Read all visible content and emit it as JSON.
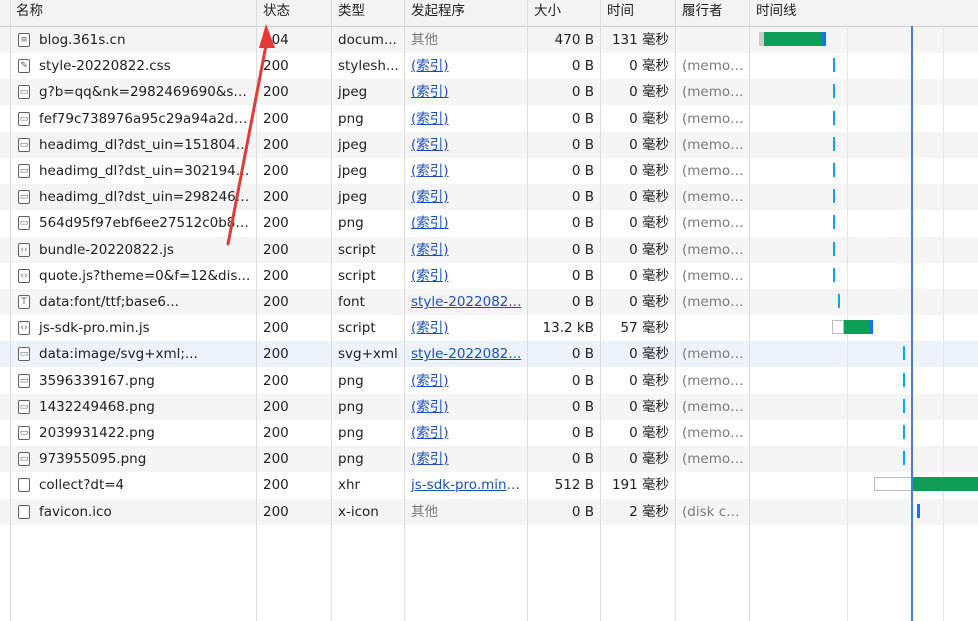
{
  "columns": {
    "name": "名称",
    "status": "状态",
    "type": "类型",
    "initiator": "发起程序",
    "size": "大小",
    "time": "时间",
    "fulfilled_by": "履行者",
    "waterfall": "时间线"
  },
  "rows": [
    {
      "name": "blog.361s.cn",
      "status": "304",
      "type": "docum...",
      "initiator": "其他",
      "initiator_link": false,
      "size": "470 B",
      "time": "131 毫秒",
      "fulfilled": "",
      "icon": "document-icon",
      "icon_glyph": "≡"
    },
    {
      "name": "style-20220822.css",
      "status": "200",
      "type": "stylesh...",
      "initiator": "(索引)",
      "initiator_link": true,
      "size": "0 B",
      "time": "0 毫秒",
      "fulfilled": "(memor...",
      "icon": "stylesheet-icon",
      "icon_glyph": "✎"
    },
    {
      "name": "g?b=qq&nk=2982469690&s=...",
      "status": "200",
      "type": "jpeg",
      "initiator": "(索引)",
      "initiator_link": true,
      "size": "0 B",
      "time": "0 毫秒",
      "fulfilled": "(memor...",
      "icon": "image-file-icon",
      "icon_glyph": "▭"
    },
    {
      "name": "fef79c738976a95c29a94a2d0e...",
      "status": "200",
      "type": "png",
      "initiator": "(索引)",
      "initiator_link": true,
      "size": "0 B",
      "time": "0 毫秒",
      "fulfilled": "(memor...",
      "icon": "image-file-icon",
      "icon_glyph": "▭"
    },
    {
      "name": "headimg_dl?dst_uin=1518048...",
      "status": "200",
      "type": "jpeg",
      "initiator": "(索引)",
      "initiator_link": true,
      "size": "0 B",
      "time": "0 毫秒",
      "fulfilled": "(memor...",
      "icon": "image-file-icon",
      "icon_glyph": "▭"
    },
    {
      "name": "headimg_dl?dst_uin=3021948...",
      "status": "200",
      "type": "jpeg",
      "initiator": "(索引)",
      "initiator_link": true,
      "size": "0 B",
      "time": "0 毫秒",
      "fulfilled": "(memor...",
      "icon": "image-file-icon",
      "icon_glyph": "▭"
    },
    {
      "name": "headimg_dl?dst_uin=2982469...",
      "status": "200",
      "type": "jpeg",
      "initiator": "(索引)",
      "initiator_link": true,
      "size": "0 B",
      "time": "0 毫秒",
      "fulfilled": "(memor...",
      "icon": "image-file-icon",
      "icon_glyph": "▭"
    },
    {
      "name": "564d95f97ebf6ee27512c0b81...",
      "status": "200",
      "type": "png",
      "initiator": "(索引)",
      "initiator_link": true,
      "size": "0 B",
      "time": "0 毫秒",
      "fulfilled": "(memor...",
      "icon": "image-file-icon",
      "icon_glyph": "▭"
    },
    {
      "name": "bundle-20220822.js",
      "status": "200",
      "type": "script",
      "initiator": "(索引)",
      "initiator_link": true,
      "size": "0 B",
      "time": "0 毫秒",
      "fulfilled": "(memor...",
      "icon": "script-icon",
      "icon_glyph": "‹›"
    },
    {
      "name": "quote.js?theme=0&f=12&dis...",
      "status": "200",
      "type": "script",
      "initiator": "(索引)",
      "initiator_link": true,
      "size": "0 B",
      "time": "0 毫秒",
      "fulfilled": "(memor...",
      "icon": "script-icon",
      "icon_glyph": "‹›"
    },
    {
      "name": "data:font/ttf;base6...",
      "status": "200",
      "type": "font",
      "initiator": "style-2022082...",
      "initiator_link": true,
      "size": "0 B",
      "time": "0 毫秒",
      "fulfilled": "(memor...",
      "icon": "font-icon",
      "icon_glyph": "T"
    },
    {
      "name": "js-sdk-pro.min.js",
      "status": "200",
      "type": "script",
      "initiator": "(索引)",
      "initiator_link": true,
      "size": "13.2 kB",
      "time": "57 毫秒",
      "fulfilled": "",
      "icon": "script-icon",
      "icon_glyph": "‹›"
    },
    {
      "name": "data:image/svg+xml;...",
      "status": "200",
      "type": "svg+xml",
      "initiator": "style-2022082...",
      "initiator_link": true,
      "size": "0 B",
      "time": "0 毫秒",
      "fulfilled": "(memor...",
      "icon": "image-file-icon",
      "icon_glyph": "▭"
    },
    {
      "name": "3596339167.png",
      "status": "200",
      "type": "png",
      "initiator": "(索引)",
      "initiator_link": true,
      "size": "0 B",
      "time": "0 毫秒",
      "fulfilled": "(memor...",
      "icon": "image-file-icon",
      "icon_glyph": "▭"
    },
    {
      "name": "1432249468.png",
      "status": "200",
      "type": "png",
      "initiator": "(索引)",
      "initiator_link": true,
      "size": "0 B",
      "time": "0 毫秒",
      "fulfilled": "(memor...",
      "icon": "image-file-icon",
      "icon_glyph": "▭"
    },
    {
      "name": "2039931422.png",
      "status": "200",
      "type": "png",
      "initiator": "(索引)",
      "initiator_link": true,
      "size": "0 B",
      "time": "0 毫秒",
      "fulfilled": "(memor...",
      "icon": "image-file-icon",
      "icon_glyph": "▭"
    },
    {
      "name": "973955095.png",
      "status": "200",
      "type": "png",
      "initiator": "(索引)",
      "initiator_link": true,
      "size": "0 B",
      "time": "0 毫秒",
      "fulfilled": "(memor...",
      "icon": "image-file-icon",
      "icon_glyph": "▭"
    },
    {
      "name": "collect?dt=4",
      "status": "200",
      "type": "xhr",
      "initiator": "js-sdk-pro.min....",
      "initiator_link": true,
      "size": "512 B",
      "time": "191 毫秒",
      "fulfilled": "",
      "icon": "xhr-icon",
      "icon_glyph": ""
    },
    {
      "name": "favicon.ico",
      "status": "200",
      "type": "x-icon",
      "initiator": "其他",
      "initiator_link": false,
      "size": "0 B",
      "time": "2 毫秒",
      "fulfilled": "(disk ca...",
      "icon": "xhr-icon",
      "icon_glyph": ""
    }
  ],
  "colors": {
    "header_bg": "#f3f3f3",
    "waiting": "#ffffff",
    "download": "#0f9d58",
    "receive": "#1a73e8",
    "cache_tick": "#03a9f4",
    "annotation_arrow": "#e53935"
  }
}
